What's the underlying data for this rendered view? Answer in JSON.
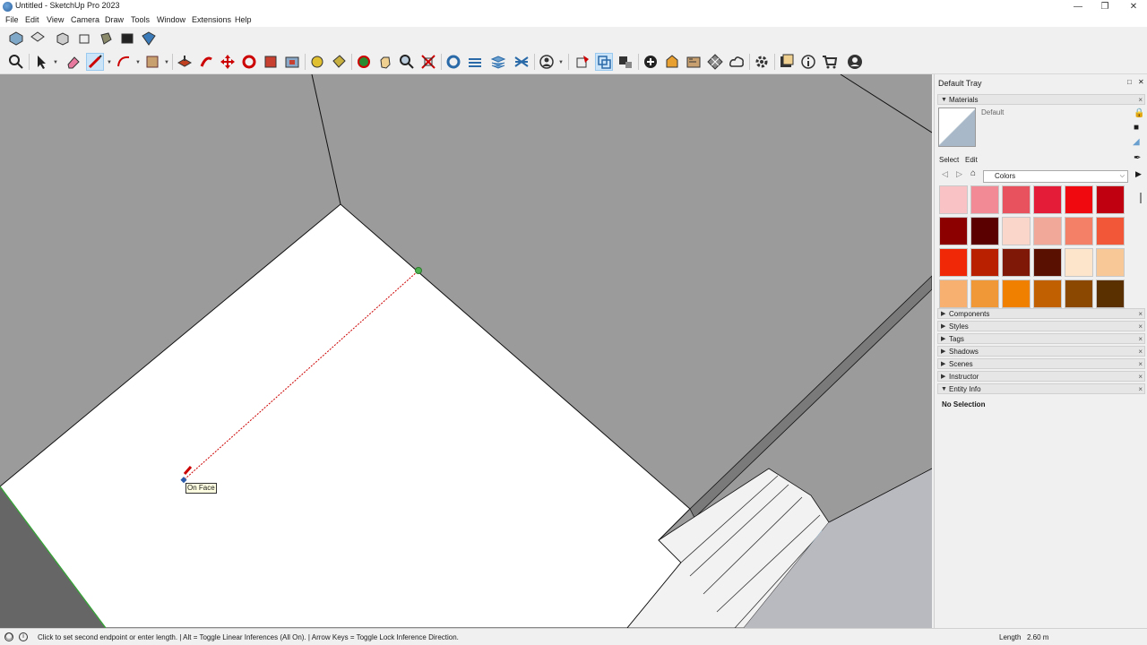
{
  "window": {
    "title": "Untitled - SketchUp Pro 2023"
  },
  "menu": [
    "File",
    "Edit",
    "View",
    "Camera",
    "Draw",
    "Tools",
    "Window",
    "Extensions",
    "Help"
  ],
  "viewport": {
    "tooltip": "On Face"
  },
  "tray": {
    "title": "Default Tray",
    "materials": {
      "header": "Materials",
      "current": "Default",
      "tabs": [
        "Select",
        "Edit"
      ],
      "collection": "Colors",
      "swatches": [
        "#f9c3c6",
        "#f28a95",
        "#e8525f",
        "#e51c38",
        "#f00a0f",
        "#c00010",
        "#8c0000",
        "#5a0000",
        "#f9d5ca",
        "#f2a898",
        "#f58068",
        "#f25838",
        "#f02808",
        "#b82000",
        "#801808",
        "#5a1000",
        "#fde5cc",
        "#f8c896",
        "#f8b070",
        "#f09838",
        "#f08000",
        "#c06000",
        "#8a4800",
        "#5a3000"
      ]
    },
    "panels": [
      "Components",
      "Styles",
      "Tags",
      "Shadows",
      "Scenes",
      "Instructor",
      "Entity Info"
    ],
    "entity_info": "No Selection"
  },
  "status": {
    "message": "Click to set second endpoint or enter length. | Alt = Toggle Linear Inferences (All On). | Arrow Keys = Toggle Lock Inference Direction.",
    "length_label": "Length",
    "length_value": "2.60 m"
  }
}
